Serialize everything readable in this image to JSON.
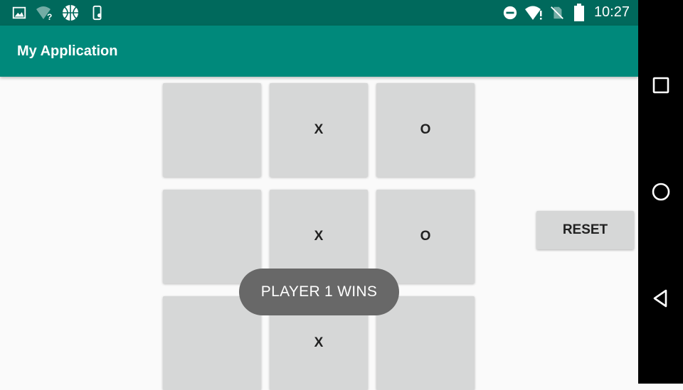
{
  "status_bar": {
    "time": "10:27",
    "icons": [
      "image-icon",
      "wifi-question-icon",
      "basketball-icon",
      "phone-icon",
      "do-not-disturb-icon",
      "wifi-alert-icon",
      "no-sim-icon",
      "battery-icon"
    ]
  },
  "app_bar": {
    "title": "My Application"
  },
  "board": {
    "cells": [
      "",
      "X",
      "O",
      "",
      "X",
      "O",
      "",
      "X",
      ""
    ]
  },
  "reset_label": "RESET",
  "toast": "PLAYER 1 WINS",
  "nav_bar": {
    "icons": [
      "recents-icon",
      "home-icon",
      "back-icon"
    ]
  },
  "colors": {
    "status_bar": "#00695c",
    "app_bar": "#00897b",
    "cell": "#d6d7d7",
    "toast": "#686868"
  }
}
